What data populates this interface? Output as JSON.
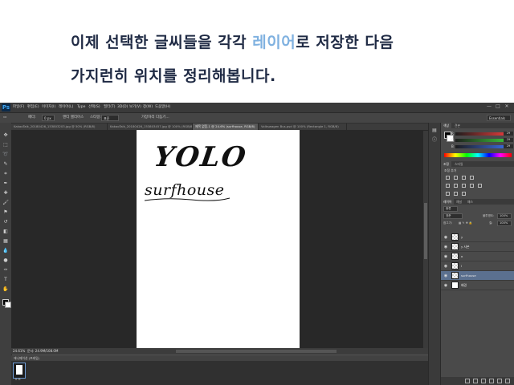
{
  "caption": {
    "line1_pre": "이제 선택한 글씨들을 각각 ",
    "line1_highlight": "레이어",
    "line1_post": "로 저장한 다음",
    "line2": "가지런히 위치를 정리해봅니다.",
    "highlight_color": "#7fb1e0",
    "text_color": "#1f2a44"
  },
  "photoshop": {
    "logo": "Ps",
    "menu": [
      "파일(F)",
      "편집(E)",
      "이미지(I)",
      "레이어(L)",
      "Type",
      "선택(S)",
      "필터(T)",
      "3D(D)",
      "보기(V)",
      "창(W)",
      "도움말(H)"
    ],
    "workspace": "Essentials",
    "window_controls": [
      "—",
      "□",
      "✕"
    ],
    "options": {
      "feather_label": "페더:",
      "feather_value": "0 px",
      "antialias_label": "앤티 앨리어스",
      "style_label": "스타일:",
      "style_value": "표준",
      "refine_label": "가장자리 다듬기..."
    },
    "tabs": [
      "KakaoTalk_20180426_153803203.jpg @ 50% (RGB/8)",
      "KakaoTalk_20180426_153803457.jpg @ 100% (RGB/8)",
      "제목 없음-1 @ 24.6% (surfhouse, RGB/8)",
      "Volkswagen Bus.psd @ 100% (Rectangle 1, RGB/8)"
    ],
    "active_tab_index": 2,
    "document": {
      "line1": "YOLO",
      "line2": "surfhouse"
    },
    "status": {
      "zoom": "24.61%",
      "doc_size": "문서: 24.9M/108.0M"
    },
    "timeline_label": "애니메이션 (프레임)",
    "frame_label": "0 초",
    "color_panel": {
      "tabs": [
        "색상",
        "견본"
      ],
      "channels": [
        {
          "label": "R",
          "value": "29",
          "color": "#e23a3a"
        },
        {
          "label": "G",
          "value": "29",
          "color": "#3ac43a"
        },
        {
          "label": "B",
          "value": "29",
          "color": "#3a6ae2"
        }
      ]
    },
    "adjust_panel": {
      "tabs": [
        "조정",
        "스타일"
      ],
      "title": "조정 추가"
    },
    "layers_panel": {
      "tabs": [
        "레이어",
        "채널",
        "패스"
      ],
      "filter": "종류",
      "blend_mode": "표준",
      "opacity_label": "불투명도:",
      "opacity_value": "100%",
      "lock_label": "잠그기:",
      "fill_label": "칠:",
      "fill_value": "100%",
      "layers": [
        {
          "name": "y",
          "selected": false,
          "checker": true
        },
        {
          "name": "y 사본",
          "selected": false,
          "checker": true
        },
        {
          "name": "o",
          "selected": false,
          "checker": true
        },
        {
          "name": "l",
          "selected": false,
          "checker": true
        },
        {
          "name": "surfhouse",
          "selected": true,
          "checker": true
        },
        {
          "name": "배경",
          "selected": false,
          "checker": false
        }
      ]
    }
  }
}
